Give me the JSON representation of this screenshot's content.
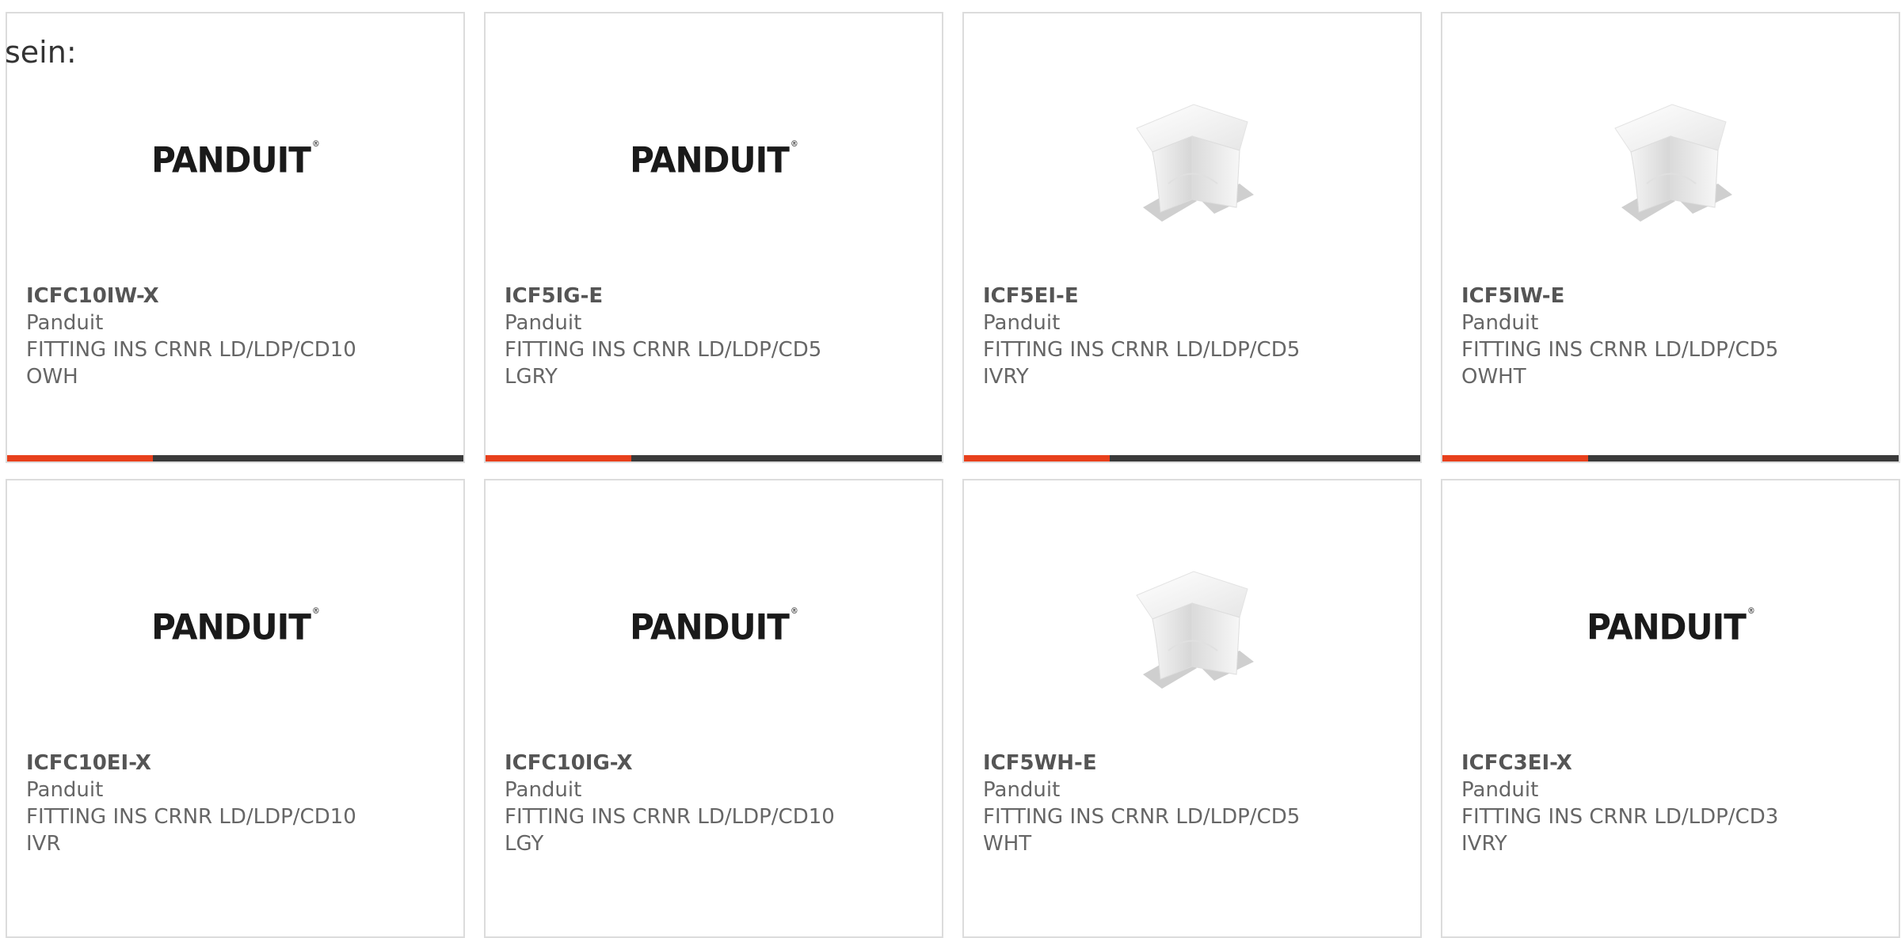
{
  "intro_text": "sein:",
  "colors": {
    "accent": "#e8401c",
    "bar": "#3a3a3a",
    "card_border": "#dcdcdc",
    "text": "#666666"
  },
  "products": [
    {
      "sku": "ICFC10IW-X",
      "brand": "Panduit",
      "desc_line1": "FITTING INS CRNR LD/LDP/CD10",
      "desc_line2": "OWH",
      "image": "logo",
      "logo_text": "PANDUIT"
    },
    {
      "sku": "ICF5IG-E",
      "brand": "Panduit",
      "desc_line1": "FITTING INS CRNR LD/LDP/CD5",
      "desc_line2": "LGRY",
      "image": "logo",
      "logo_text": "PANDUIT"
    },
    {
      "sku": "ICF5EI-E",
      "brand": "Panduit",
      "desc_line1": "FITTING INS CRNR LD/LDP/CD5",
      "desc_line2": "IVRY",
      "image": "fitting",
      "logo_text": ""
    },
    {
      "sku": "ICF5IW-E",
      "brand": "Panduit",
      "desc_line1": "FITTING INS CRNR LD/LDP/CD5",
      "desc_line2": "OWHT",
      "image": "fitting",
      "logo_text": ""
    },
    {
      "sku": "ICFC10EI-X",
      "brand": "Panduit",
      "desc_line1": "FITTING INS CRNR LD/LDP/CD10",
      "desc_line2": "IVR",
      "image": "logo",
      "logo_text": "PANDUIT"
    },
    {
      "sku": "ICFC10IG-X",
      "brand": "Panduit",
      "desc_line1": "FITTING INS CRNR LD/LDP/CD10",
      "desc_line2": "LGY",
      "image": "logo",
      "logo_text": "PANDUIT"
    },
    {
      "sku": "ICF5WH-E",
      "brand": "Panduit",
      "desc_line1": "FITTING INS CRNR LD/LDP/CD5",
      "desc_line2": "WHT",
      "image": "fitting",
      "logo_text": ""
    },
    {
      "sku": "ICFC3EI-X",
      "brand": "Panduit",
      "desc_line1": "FITTING INS CRNR LD/LDP/CD3",
      "desc_line2": "IVRY",
      "image": "logo",
      "logo_text": "PANDUIT"
    }
  ]
}
